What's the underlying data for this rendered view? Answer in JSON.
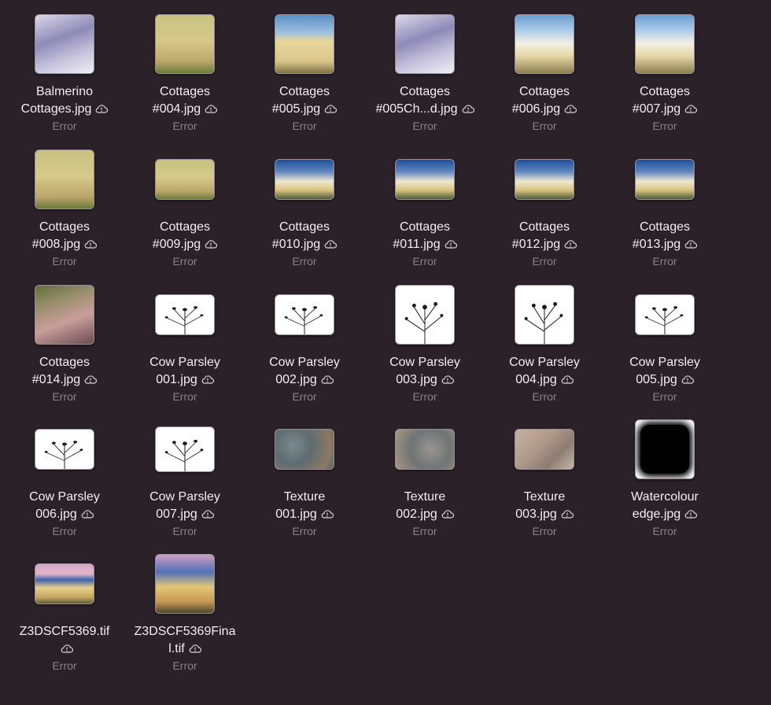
{
  "status_text": "Error",
  "items": [
    {
      "line1": "Balmerino",
      "line2": "Cottages.jpg",
      "look": "t-balm",
      "icon": "photo-thumbnail"
    },
    {
      "line1": "Cottages",
      "line2": "#004.jpg",
      "look": "t-cot-yellow",
      "icon": "photo-thumbnail"
    },
    {
      "line1": "Cottages",
      "line2": "#005.jpg",
      "look": "t-cot-sky",
      "icon": "photo-thumbnail"
    },
    {
      "line1": "Cottages",
      "line2": "#005Ch...d.jpg",
      "look": "t-balm",
      "icon": "photo-thumbnail"
    },
    {
      "line1": "Cottages",
      "line2": "#006.jpg",
      "look": "t-cot-white",
      "icon": "photo-thumbnail"
    },
    {
      "line1": "Cottages",
      "line2": "#007.jpg",
      "look": "t-cot-white",
      "icon": "photo-thumbnail"
    },
    {
      "line1": "Cottages",
      "line2": "#008.jpg",
      "look": "t-cot-yellow",
      "icon": "photo-thumbnail"
    },
    {
      "line1": "Cottages",
      "line2": "#009.jpg",
      "look": "t-cot-yellow",
      "icon": "photo-thumbnail"
    },
    {
      "line1": "Cottages",
      "line2": "#010.jpg",
      "look": "t-cot-dark",
      "icon": "photo-thumbnail"
    },
    {
      "line1": "Cottages",
      "line2": "#011.jpg",
      "look": "t-cot-dark",
      "icon": "photo-thumbnail"
    },
    {
      "line1": "Cottages",
      "line2": "#012.jpg",
      "look": "t-cot-dark",
      "icon": "photo-thumbnail"
    },
    {
      "line1": "Cottages",
      "line2": "#013.jpg",
      "look": "t-cot-dark",
      "icon": "photo-thumbnail"
    },
    {
      "line1": "Cottages",
      "line2": "#014.jpg",
      "look": "t-cot-14",
      "icon": "photo-thumbnail"
    },
    {
      "line1": "Cow Parsley",
      "line2": "001.jpg",
      "look": "t-parsley",
      "icon": "plant-thumbnail"
    },
    {
      "line1": "Cow Parsley",
      "line2": "002.jpg",
      "look": "t-parsley",
      "icon": "plant-thumbnail"
    },
    {
      "line1": "Cow Parsley",
      "line2": "003.jpg",
      "look": "t-parsley",
      "icon": "plant-thumbnail"
    },
    {
      "line1": "Cow Parsley",
      "line2": "004.jpg",
      "look": "t-parsley",
      "icon": "plant-thumbnail"
    },
    {
      "line1": "Cow Parsley",
      "line2": "005.jpg",
      "look": "t-parsley",
      "icon": "plant-thumbnail"
    },
    {
      "line1": "Cow Parsley",
      "line2": "006.jpg",
      "look": "t-parsley",
      "icon": "plant-thumbnail"
    },
    {
      "line1": "Cow Parsley",
      "line2": "007.jpg",
      "look": "t-parsley",
      "icon": "plant-thumbnail"
    },
    {
      "line1": "Texture",
      "line2": "001.jpg",
      "look": "t-tex1",
      "icon": "texture-thumbnail"
    },
    {
      "line1": "Texture",
      "line2": "002.jpg",
      "look": "t-tex2",
      "icon": "texture-thumbnail"
    },
    {
      "line1": "Texture",
      "line2": "003.jpg",
      "look": "t-tex3",
      "icon": "texture-thumbnail"
    },
    {
      "line1": "Watercolour",
      "line2": "edge.jpg",
      "look": "t-water",
      "icon": "texture-thumbnail"
    },
    {
      "line1": "Z3DSCF5369.tif",
      "line2": "",
      "look": "t-z3",
      "icon": "photo-thumbnail"
    },
    {
      "line1": "Z3DSCF5369Fina",
      "line2": "l.tif",
      "look": "t-z3f",
      "icon": "photo-thumbnail"
    }
  ]
}
